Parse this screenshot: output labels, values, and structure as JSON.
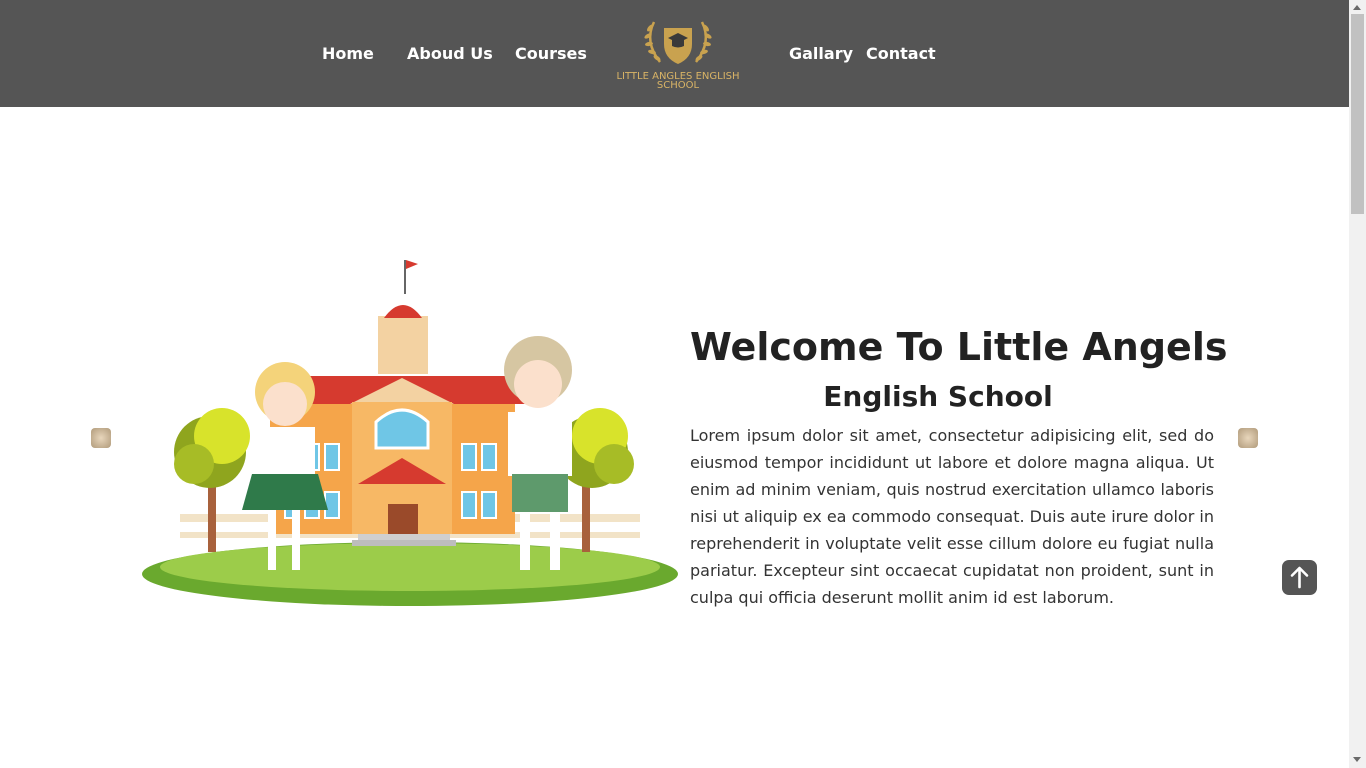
{
  "nav": {
    "links": [
      "Home",
      "Aboud Us",
      "Courses",
      "Gallary",
      "Contact"
    ],
    "logo": {
      "line1": "LITTLE ANGLES ENGLISH",
      "line2": "SCHOOL",
      "icon": "laurel-mortarboard-shield-icon"
    }
  },
  "hero": {
    "title": "Welcome To Little Angels",
    "subtitle": "English School",
    "paragraph": "Lorem ipsum dolor sit amet, consectetur adipisicing elit, sed do eiusmod tempor incididunt ut labore et dolore magna aliqua. Ut enim ad minim veniam, quis nostrud exercitation ullamco laboris nisi ut aliquip ex ea commodo consequat. Duis aute irure dolor in reprehenderit in voluptate velit esse cillum dolore eu fugiat nulla pariatur. Excepteur sint occaecat cupidatat non proident, sunt in culpa qui officia deserunt mollit anim id est laborum.",
    "image": "school-building-with-two-kids-illustration"
  },
  "carousel": {
    "prev_icon": "carousel-prev-icon",
    "next_icon": "carousel-next-icon"
  },
  "scroll_top": {
    "icon": "arrow-up-icon"
  },
  "colors": {
    "navbar": "#555555",
    "accent_gold": "#d9b466",
    "text_dark": "#222222"
  }
}
